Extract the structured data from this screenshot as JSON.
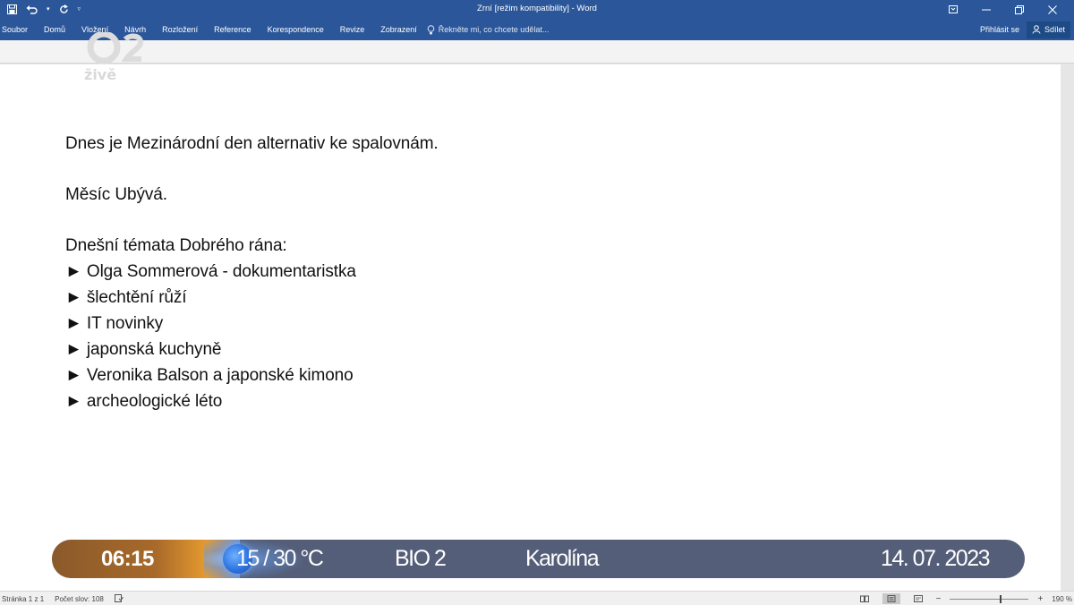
{
  "window": {
    "title": "Zrní [režim kompatibility] - Word",
    "min_icon": "minimize-icon",
    "restore_icon": "restore-icon",
    "close_icon": "close-icon"
  },
  "ribbon": {
    "tabs": [
      "Soubor",
      "Domů",
      "Vložení",
      "Návrh",
      "Rozložení",
      "Reference",
      "Korespondence",
      "Revize",
      "Zobrazení"
    ],
    "tell_me_placeholder": "Řekněte mi, co chcete udělat...",
    "sign_in": "Přihlásit se",
    "share": "Sdílet"
  },
  "document": {
    "lines": [
      "Dnes je Mezinárodní den alternativ ke spalovnám.",
      "Měsíc Ubývá.",
      "Dnešní témata Dobrého rána:"
    ],
    "bullets": [
      "► Olga Sommerová - dokumentaristka",
      "► šlechtění růží",
      "► IT novinky",
      "► japonská kuchyně",
      "► Veronika Balson a japonské kimono",
      "► archeologické léto"
    ]
  },
  "overlay": {
    "logo_text": "živě",
    "time": "06:15",
    "temperature": "15 / 30 °C",
    "channel": "BIO 2",
    "name_day": "Karolína",
    "date": "14. 07. 2023"
  },
  "status": {
    "page": "Stránka 1 z 1",
    "words": "Počet slov: 108",
    "zoom": "190 %"
  },
  "colors": {
    "ribbon": "#2b579a",
    "ticker": "#545e78",
    "ticker_time": "#a8692a"
  }
}
